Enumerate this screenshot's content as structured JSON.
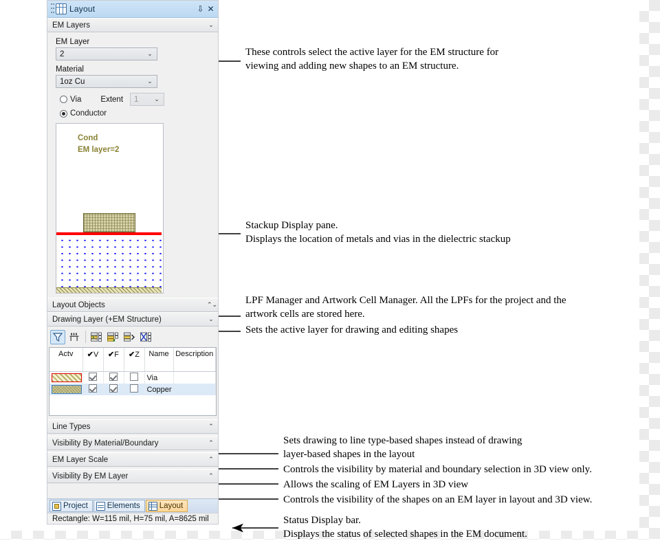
{
  "panel": {
    "titlebar": {
      "title": "Layout",
      "pin_icon": "pin-icon",
      "close_icon": "close-icon",
      "app_icon": "layout-grid-icon"
    },
    "em_layers": {
      "header": "EM Layers",
      "em_layer_label": "EM Layer",
      "em_layer_value": "2",
      "material_label": "Material",
      "material_value": "1oz Cu",
      "via_label": "Via",
      "extent_label": "Extent",
      "extent_value": "1",
      "conductor_label": "Conductor",
      "selected_radio": "Conductor"
    },
    "stackup": {
      "label_line1": "Cond",
      "label_line2": "EM layer=2",
      "label_color": "#8a8235",
      "metal_color": "#d6d2a8",
      "boundary_color": "#ff0000",
      "dielectric_dot_color": "#1414ff"
    },
    "layout_objects": {
      "header": "Layout Objects"
    },
    "drawing_layer": {
      "header": "Drawing Layer (+EM Structure)",
      "toolbar": [
        {
          "name": "filter-icon",
          "selected": true
        },
        {
          "name": "table-columns-icon",
          "selected": false
        },
        {
          "name": "new-layer-icon",
          "selected": false
        },
        {
          "name": "insert-layer-icon",
          "selected": false
        },
        {
          "name": "move-layer-icon",
          "selected": false
        },
        {
          "name": "delete-layer-icon",
          "selected": false
        }
      ],
      "columns": [
        "Actv",
        "V",
        "F",
        "Z",
        "Name",
        "Description"
      ],
      "rows": [
        {
          "swatch": "via-hatch",
          "v": true,
          "f": true,
          "z": false,
          "name": "Via",
          "description": ""
        },
        {
          "swatch": "copper-hatch",
          "v": true,
          "f": true,
          "z": false,
          "name": "Copper",
          "description": ""
        }
      ]
    },
    "sections": [
      {
        "header": "Line Types"
      },
      {
        "header": "Visibility By Material/Boundary"
      },
      {
        "header": "EM Layer Scale"
      },
      {
        "header": "Visibility By EM Layer"
      }
    ],
    "tabs": [
      {
        "label": "Project",
        "icon": "project-icon",
        "active": false
      },
      {
        "label": "Elements",
        "icon": "elements-icon",
        "active": false
      },
      {
        "label": "Layout",
        "icon": "layout-grid-icon",
        "active": true
      }
    ],
    "status": "Rectangle: W=115 mil, H=75 mil, A=8625 mil"
  },
  "annotations": [
    {
      "id": "em-layer-note",
      "text": "These controls select the active layer for the EM structure for\nviewing and adding new shapes to an EM structure."
    },
    {
      "id": "stackup-note",
      "text": "Stackup Display pane.\nDisplays the location of metals and vias in the dielectric stackup"
    },
    {
      "id": "lpf-note",
      "text": "LPF Manager and Artwork Cell Manager. All the LPFs for the project and the\nartwork cells are stored here."
    },
    {
      "id": "drawing-layer-note",
      "text": "Sets the active layer for drawing and editing shapes"
    },
    {
      "id": "line-types-note",
      "text": "Sets drawing to line type-based shapes instead of drawing\nlayer-based shapes in the layout"
    },
    {
      "id": "visibility-material-note",
      "text": "Controls the visibility by material and boundary selection in 3D view only."
    },
    {
      "id": "em-layer-scale-note",
      "text": "Allows the scaling of EM Layers in 3D view"
    },
    {
      "id": "visibility-em-layer-note",
      "text": "Controls the visibility of the shapes on an EM layer in layout and 3D view."
    },
    {
      "id": "status-note",
      "text": "Status Display bar.\nDisplays the status of selected shapes in the EM document."
    }
  ]
}
